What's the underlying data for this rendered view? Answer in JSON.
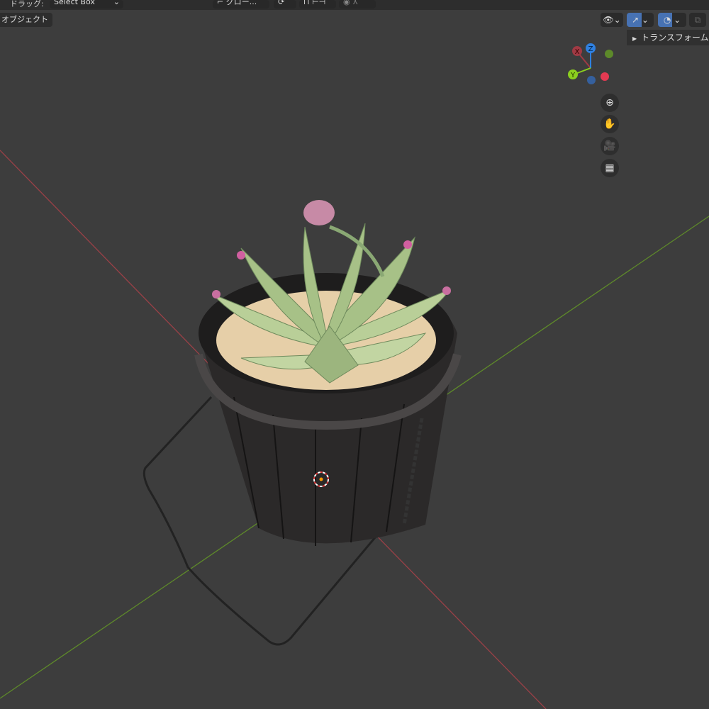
{
  "toolbar": {
    "drag_label": "ドラッグ:",
    "select_mode": "Select Box",
    "orientation": "グロー...",
    "object_mode_tab": "オブジェクト"
  },
  "sidebar_panel": {
    "transform_label": "トランスフォーム"
  },
  "gizmo": {
    "x": "X",
    "y": "Y",
    "z": "Z"
  },
  "nav_icons": [
    "zoom-icon",
    "hand-pan-icon",
    "camera-icon",
    "grid-ortho-icon"
  ],
  "colors": {
    "x_axis": "#c0484f",
    "y_axis": "#6a9a2a",
    "z_axis": "#2f80e0",
    "accent": "#4772b3"
  }
}
